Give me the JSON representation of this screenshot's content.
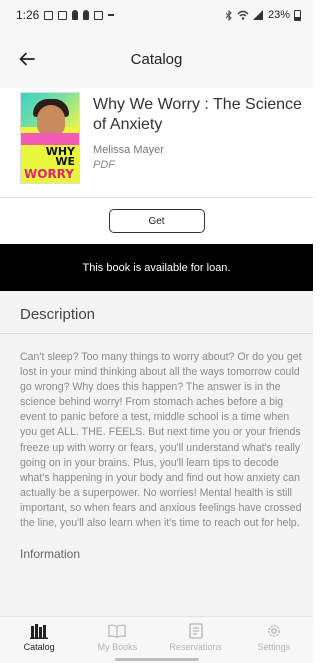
{
  "status_bar": {
    "time": "1:26",
    "battery_text": "23%"
  },
  "header": {
    "title": "Catalog",
    "back_icon": "arrow-left-icon"
  },
  "book": {
    "title": "Why We Worry : The Science of Anxiety",
    "author": "Melissa Mayer",
    "format": "PDF",
    "cover_text": {
      "line1": "WHY",
      "line2": "WE",
      "line3": "WORRY"
    }
  },
  "actions": {
    "get_label": "Get"
  },
  "banner": {
    "text": "This book is available for loan."
  },
  "description": {
    "heading": "Description",
    "body": "Can't sleep? Too many things to worry about? Or do you get lost in your mind thinking about all the ways tomorrow could go wrong? Why does this happen? The answer is in the science behind worry! From stomach aches before a big event to panic before a test, middle school is a time when you get ALL. THE. FEELS. But next time you or your friends freeze up with worry or fears, you'll understand what's really going on in your brains. Plus, you'll learn tips to decode what's happening in your body and find out how anxiety can actually be a superpower. No worries! Mental health is still important, so when fears and anxious feelings have crossed the line, you'll also learn when it's time to reach out for help."
  },
  "information": {
    "heading": "Information"
  },
  "tabs": [
    {
      "label": "Catalog",
      "icon": "catalog-icon",
      "active": true
    },
    {
      "label": "My Books",
      "icon": "book-icon",
      "active": false
    },
    {
      "label": "Reservations",
      "icon": "reservations-icon",
      "active": false
    },
    {
      "label": "Settings",
      "icon": "gear-icon",
      "active": false
    }
  ],
  "colors": {
    "banner_bg": "#000000",
    "banner_text": "#ffffff",
    "active_tab": "#222222",
    "inactive_tab": "#b5b5b5"
  }
}
